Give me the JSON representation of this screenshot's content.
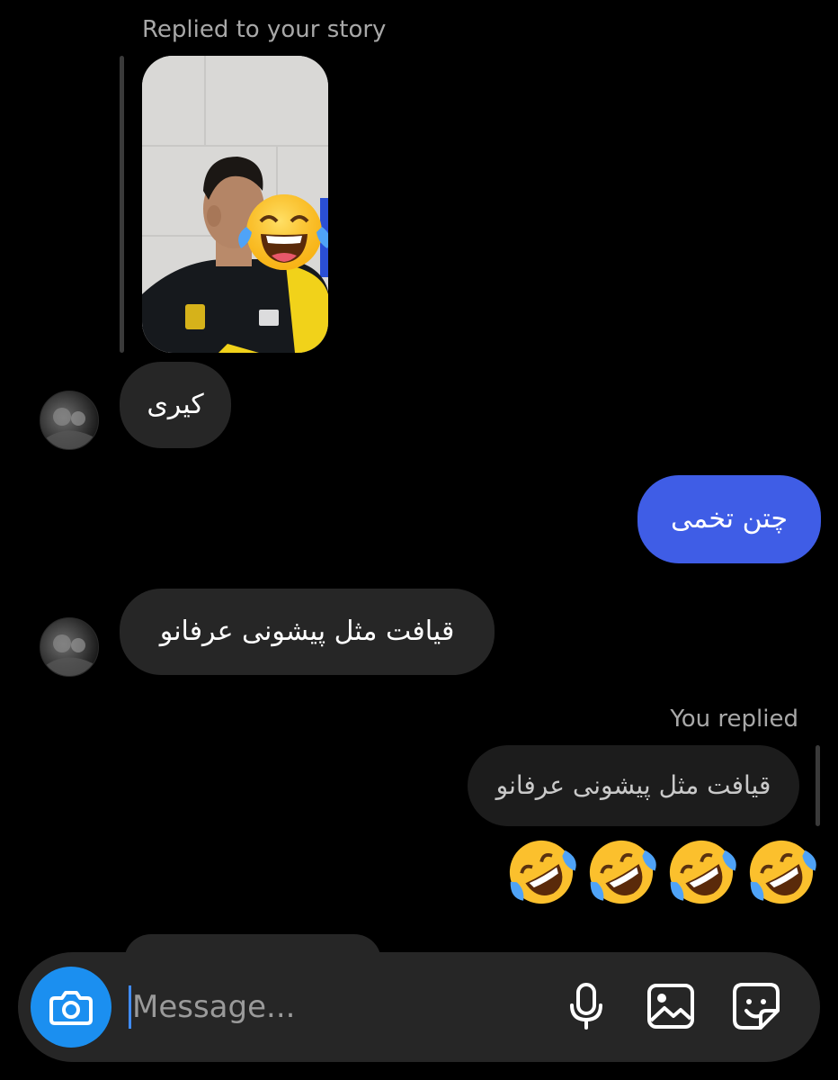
{
  "story": {
    "caption": "Replied to your story",
    "emoji": "face-with-tears-of-joy"
  },
  "messages": [
    {
      "text": "کیری",
      "direction": "incoming"
    },
    {
      "text": "چتن تخمی",
      "direction": "outgoing"
    },
    {
      "text": "قیافت مثل پیشونی عرفانو",
      "direction": "incoming"
    }
  ],
  "reply": {
    "label": "You replied",
    "quoted_text": "قیافت مثل پیشونی عرفانو",
    "emoji_count": 4,
    "emoji": "rolling-on-the-floor-laughing"
  },
  "composer": {
    "placeholder": "Message...",
    "icons": [
      "camera-icon",
      "microphone-icon",
      "gallery-icon",
      "sticker-icon"
    ]
  },
  "colors": {
    "outgoing_bubble": "#3f5de6",
    "incoming_bubble": "#262626",
    "camera_button": "#1b8ff0"
  }
}
